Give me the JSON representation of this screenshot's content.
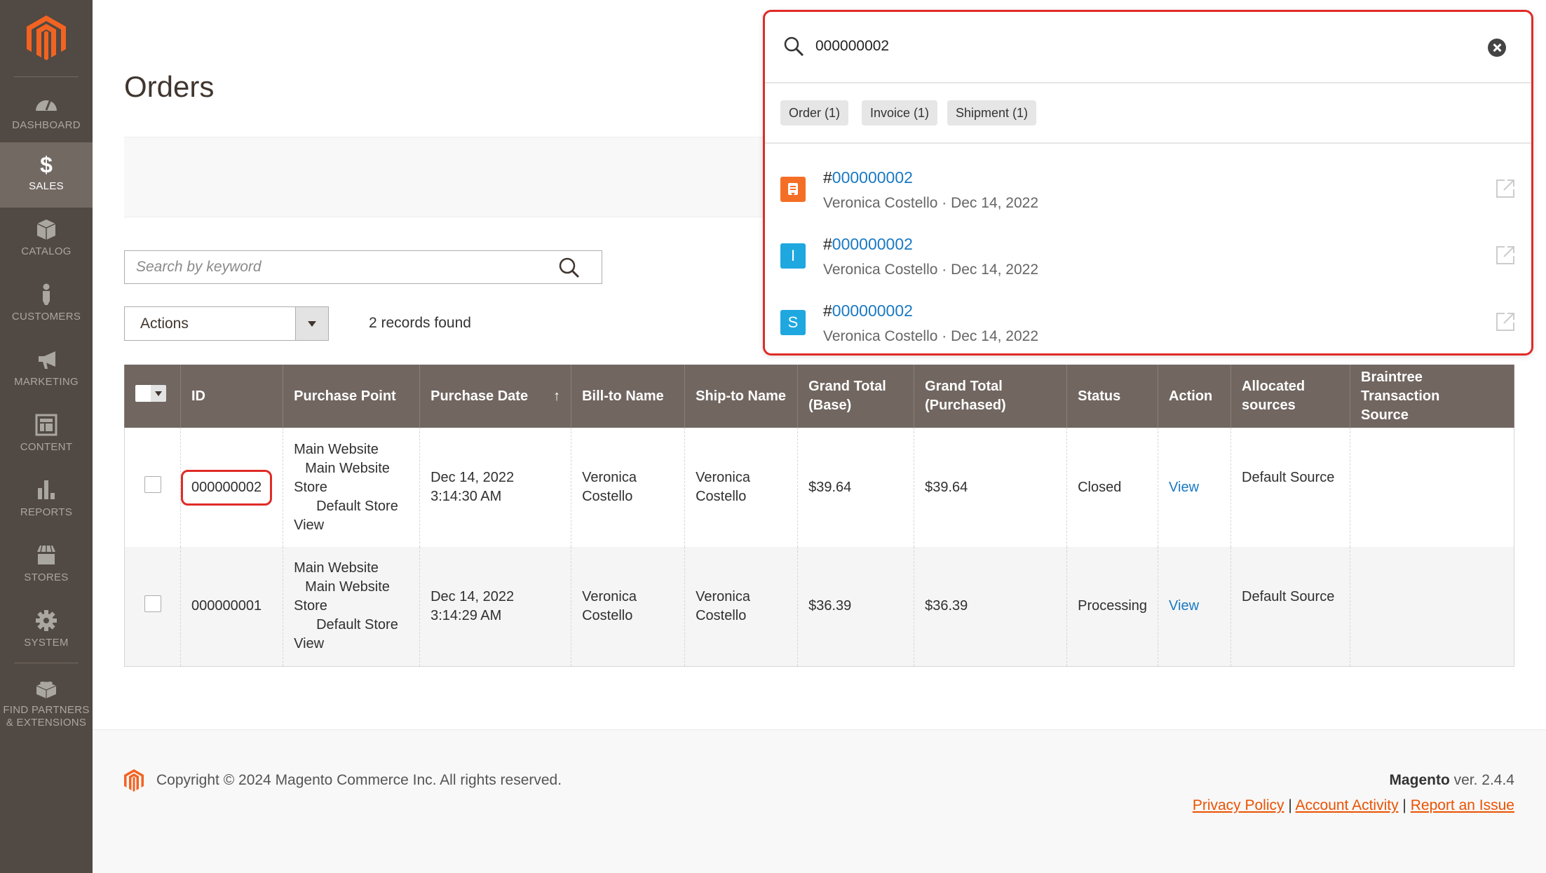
{
  "sidebar": {
    "items": [
      {
        "label": "DASHBOARD",
        "icon": "dashboard-icon",
        "active": false
      },
      {
        "label": "SALES",
        "icon": "dollar-icon",
        "active": true
      },
      {
        "label": "CATALOG",
        "icon": "box-icon",
        "active": false
      },
      {
        "label": "CUSTOMERS",
        "icon": "person-icon",
        "active": false
      },
      {
        "label": "MARKETING",
        "icon": "megaphone-icon",
        "active": false
      },
      {
        "label": "CONTENT",
        "icon": "layout-icon",
        "active": false
      },
      {
        "label": "REPORTS",
        "icon": "bar-chart-icon",
        "active": false
      },
      {
        "label": "STORES",
        "icon": "storefront-icon",
        "active": false
      },
      {
        "label": "SYSTEM",
        "icon": "gear-icon",
        "active": false
      },
      {
        "label": "FIND PARTNERS",
        "label2": "& EXTENSIONS",
        "icon": "lego-brick-icon",
        "active": false
      }
    ]
  },
  "page": {
    "title": "Orders"
  },
  "toolbar": {
    "search_placeholder": "Search by keyword",
    "search_value": "",
    "actions_label": "Actions",
    "records_found": "2 records found"
  },
  "grid": {
    "columns": [
      "ID",
      "Purchase Point",
      "Purchase Date",
      "Bill-to Name",
      "Ship-to Name",
      "Grand Total (Base)",
      "Grand Total (Purchased)",
      "Status",
      "Action",
      "Allocated sources",
      "Braintree Transaction Source"
    ],
    "col_headers_split": {
      "grand_base": [
        "Grand Total",
        "(Base)"
      ],
      "grand_purchased": [
        "Grand Total",
        "(Purchased)"
      ],
      "allocated": [
        "Allocated",
        "sources"
      ],
      "braintree": [
        "Braintree Transaction",
        "Source"
      ]
    },
    "sort_indicator": "↑",
    "rows": [
      {
        "id": "000000002",
        "purchase_point": [
          "Main Website",
          "Main Website",
          "Store",
          "Default Store",
          "View"
        ],
        "date": "Dec 14, 2022",
        "time": "3:14:30 AM",
        "bill_to": [
          "Veronica",
          "Costello"
        ],
        "ship_to": [
          "Veronica",
          "Costello"
        ],
        "grand_base": "$39.64",
        "grand_purchased": "$39.64",
        "status": "Closed",
        "action": "View",
        "allocated": "Default Source",
        "braintree": "",
        "highlighted": true
      },
      {
        "id": "000000001",
        "purchase_point": [
          "Main Website",
          "Main Website",
          "Store",
          "Default Store",
          "View"
        ],
        "date": "Dec 14, 2022",
        "time": "3:14:29 AM",
        "bill_to": [
          "Veronica",
          "Costello"
        ],
        "ship_to": [
          "Veronica",
          "Costello"
        ],
        "grand_base": "$36.39",
        "grand_purchased": "$36.39",
        "status": "Processing",
        "action": "View",
        "allocated": "Default Source",
        "braintree": "",
        "highlighted": false
      }
    ]
  },
  "global_search": {
    "query": "000000002",
    "filters": [
      "Order (1)",
      "Invoice (1)",
      "Shipment (1)"
    ],
    "results": [
      {
        "type": "order",
        "badge": "",
        "badge_color": "#f46f25",
        "prefix": "#",
        "number": "000000002",
        "meta": "Veronica Costello · Dec 14, 2022"
      },
      {
        "type": "invoice",
        "badge": "I",
        "badge_color": "#1fa7e0",
        "prefix": "#",
        "number": "000000002",
        "meta": "Veronica Costello · Dec 14, 2022"
      },
      {
        "type": "shipment",
        "badge": "S",
        "badge_color": "#1fa7e0",
        "prefix": "#",
        "number": "000000002",
        "meta": "Veronica Costello · Dec 14, 2022"
      }
    ]
  },
  "footer": {
    "copyright": "Copyright © 2024 Magento Commerce Inc. All rights reserved.",
    "brand": "Magento",
    "version": " ver. 2.4.4",
    "links": [
      "Privacy Policy",
      "Account Activity",
      "Report an Issue"
    ],
    "separator": "|"
  },
  "colors": {
    "brand_orange": "#eb5202",
    "sidebar_bg": "#514943",
    "sidebar_active": "#736963",
    "header_bg": "#716660",
    "link_blue": "#1979c3",
    "highlight_red": "#e02b27"
  }
}
